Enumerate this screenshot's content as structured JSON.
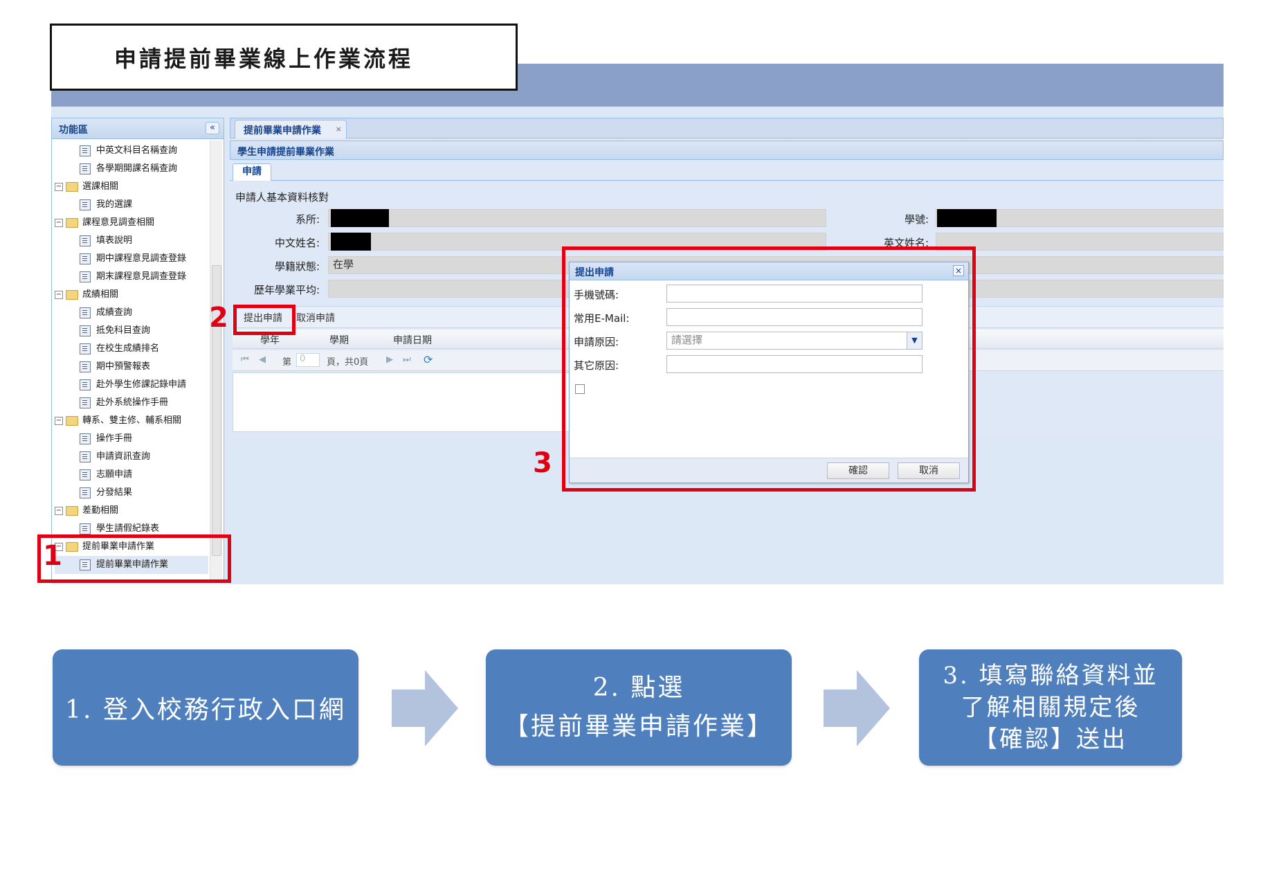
{
  "page_title": "申請提前畢業線上作業流程",
  "sidebar": {
    "header": "功能區",
    "collapse": "«",
    "items": [
      {
        "label": "中英文科目名稱查詢",
        "kind": "leaf"
      },
      {
        "label": "各學期開課名稱查詢",
        "kind": "leaf"
      },
      {
        "label": "選課相關",
        "kind": "folder"
      },
      {
        "label": "我的選課",
        "kind": "leaf"
      },
      {
        "label": "課程意見調查相關",
        "kind": "folder"
      },
      {
        "label": "填表說明",
        "kind": "leaf"
      },
      {
        "label": "期中課程意見調查登錄",
        "kind": "leaf"
      },
      {
        "label": "期末課程意見調查登錄",
        "kind": "leaf"
      },
      {
        "label": "成績相關",
        "kind": "folder"
      },
      {
        "label": "成績查詢",
        "kind": "leaf"
      },
      {
        "label": "抵免科目查詢",
        "kind": "leaf"
      },
      {
        "label": "在校生成績排名",
        "kind": "leaf"
      },
      {
        "label": "期中預警報表",
        "kind": "leaf"
      },
      {
        "label": "赴外學生修課記錄申請",
        "kind": "leaf"
      },
      {
        "label": "赴外系統操作手冊",
        "kind": "leaf"
      },
      {
        "label": "轉系、雙主修、輔系相關",
        "kind": "folder"
      },
      {
        "label": "操作手冊",
        "kind": "leaf"
      },
      {
        "label": "申請資訊查詢",
        "kind": "leaf"
      },
      {
        "label": "志願申請",
        "kind": "leaf"
      },
      {
        "label": "分發結果",
        "kind": "leaf"
      },
      {
        "label": "差勤相關",
        "kind": "folder"
      },
      {
        "label": "學生請假紀錄表",
        "kind": "leaf"
      },
      {
        "label": "提前畢業申請作業",
        "kind": "folder"
      },
      {
        "label": "提前畢業申請作業",
        "kind": "leaf",
        "selected": true
      }
    ]
  },
  "main": {
    "tab": "提前畢業申請作業",
    "tab_close": "×",
    "panel_title": "學生申請提前畢業作業",
    "subtab": "申請",
    "section": "申請人基本資料核對",
    "fields": {
      "dept_label": "系所:",
      "student_id_label": "學號:",
      "cname_label": "中文姓名:",
      "ename_label": "英文姓名:",
      "status_label": "學籍狀態:",
      "status_value": "在學",
      "gpa_label": "歷年學業平均:"
    },
    "toolbar": {
      "submit": "提出申請",
      "cancel": "取消申請"
    },
    "grid_headers": [
      "學年",
      "學期",
      "申請日期"
    ],
    "pager": {
      "page_prefix": "第",
      "page_value": "0",
      "page_suffix": "頁，共0頁"
    }
  },
  "dialog": {
    "title": "提出申請",
    "close": "×",
    "phone_label": "手機號碼:",
    "email_label": "常用E-Mail:",
    "reason_label": "申請原因:",
    "reason_placeholder": "請選擇",
    "other_label": "其它原因:",
    "confirm": "確認",
    "cancel": "取消"
  },
  "callouts": [
    "1",
    "2",
    "3"
  ],
  "flow": {
    "step1": [
      "1. 登入校務行政入口網"
    ],
    "step2": [
      "2. 點選",
      "【提前畢業申請作業】"
    ],
    "step3": [
      "3. 填寫聯絡資料並",
      "了解相關規定後",
      "【確認】送出"
    ]
  },
  "colors": {
    "highlight": "#e00012",
    "step_fill": "#4f80bd",
    "arrow_fill": "#b3c3de",
    "header_band": "#8aa0c8"
  }
}
